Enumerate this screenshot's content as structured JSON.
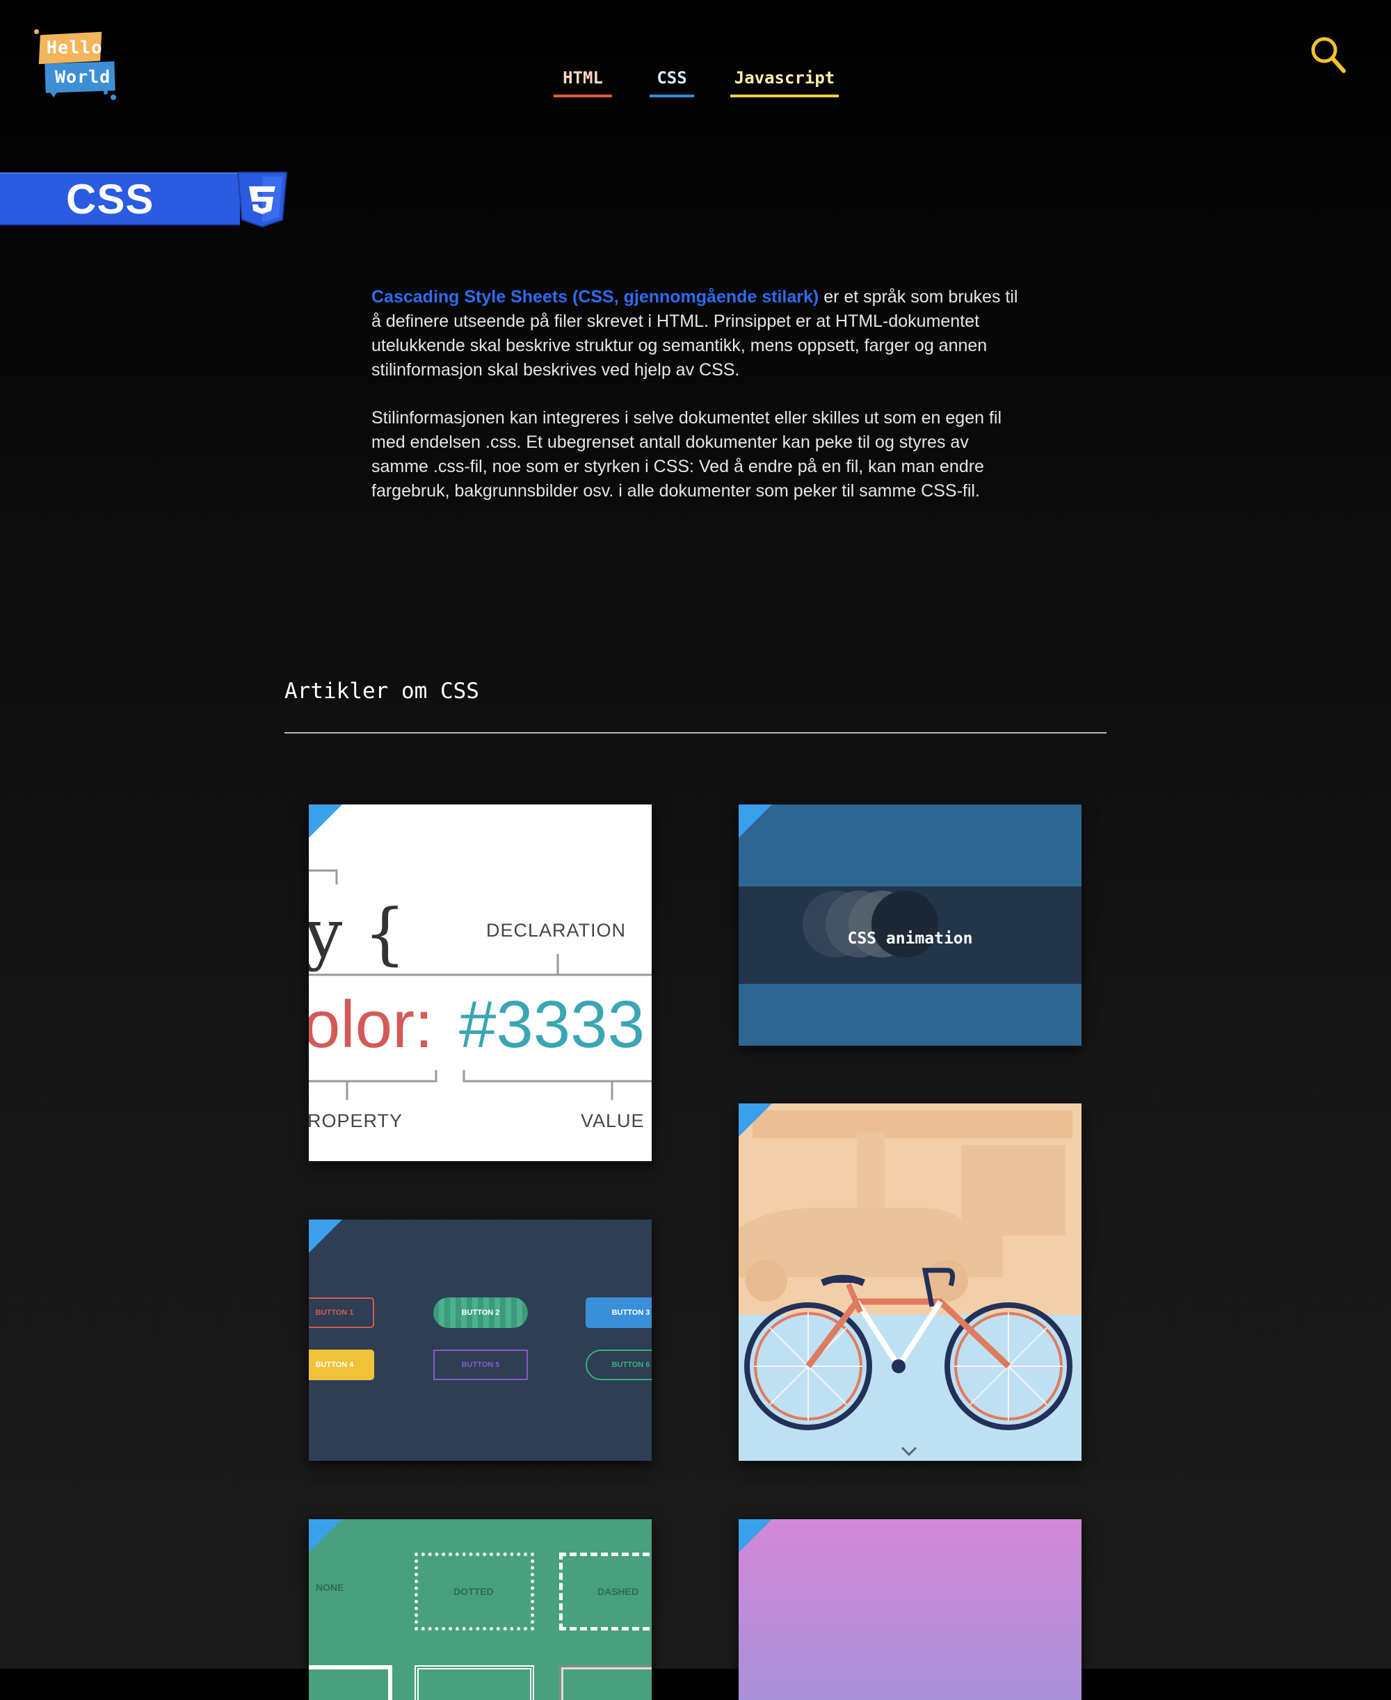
{
  "logo": {
    "line1": "Hello",
    "line2": "World"
  },
  "nav": {
    "items": [
      {
        "label": "HTML"
      },
      {
        "label": "CSS"
      },
      {
        "label": "Javascript"
      }
    ]
  },
  "banner": {
    "label": "CSS"
  },
  "intro": {
    "link": "Cascading Style Sheets (CSS, gjennomgående stilark)",
    "p1_rest": " er et språk som brukes til å definere utseende på filer skrevet i HTML. Prinsippet er at HTML-dokumentet utelukkende skal beskrive struktur og semantikk, mens oppsett, farger og annen stilinformasjon skal beskrives ved hjelp av CSS.",
    "p2": "Stilinformasjonen kan integreres i selve dokumentet eller skilles ut som en egen fil med endelsen .css. Et ubegrenset antall dokumenter kan peke til og styres av samme .css-fil, noe som er styrken i CSS: Ved å endre på en fil, kan man endre fargebruk, bakgrunnsbilder osv. i alle dokumenter som peker til samme CSS-fil."
  },
  "articles": {
    "title": "Artikler om CSS",
    "card1": {
      "brace_char": "y {",
      "declaration": "DECLARATION",
      "color_part": "olor:",
      "value_part": "#3333",
      "property": "ROPERTY",
      "value": "VALUE"
    },
    "card2": {
      "caption": "CSS animation"
    },
    "card3": {
      "b1": "BUTTON 1",
      "b2": "BUTTON 2",
      "b3": "BUTTON 3",
      "b4": "BUTTON 4",
      "b5": "BUTTON 5",
      "b6": "BUTTON 6"
    },
    "card5": {
      "none": "NONE",
      "dotted": "DOTTED",
      "dashed": "DASHED"
    }
  },
  "colors": {
    "accent_html": "#e25b2b",
    "accent_css": "#2b8ee0",
    "accent_js": "#f2d13a",
    "link": "#2c6cf0",
    "search": "#f2c230"
  },
  "icons": [
    "logo",
    "search-icon",
    "css3-shield-icon",
    "card-corner-icon"
  ]
}
